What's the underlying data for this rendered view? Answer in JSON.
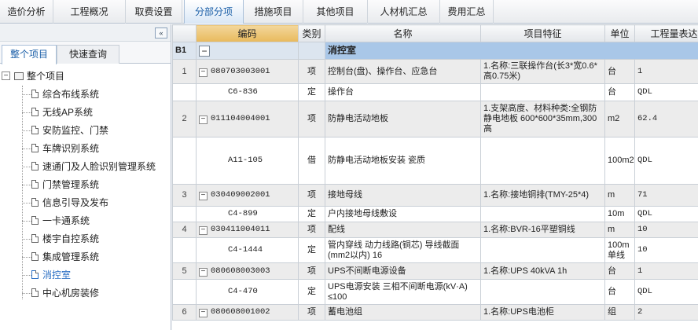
{
  "top_tabs": [
    {
      "label": "造价分析"
    },
    {
      "label": "工程概况"
    },
    {
      "label": "取费设置"
    },
    {
      "label": "分部分项",
      "active": true
    },
    {
      "label": "措施项目"
    },
    {
      "label": "其他项目"
    },
    {
      "label": "人材机汇总"
    },
    {
      "label": "费用汇总"
    }
  ],
  "left": {
    "collapse_glyph": "«",
    "tabs": [
      {
        "label": "整个项目"
      },
      {
        "label": "快速查询"
      }
    ],
    "root": "整个项目",
    "items": [
      "综合布线系统",
      "无线AP系统",
      "安防监控、门禁",
      "车牌识别系统",
      "速通门及人脸识别管理系统",
      "门禁管理系统",
      "信息引导及发布",
      "一卡通系统",
      "楼宇自控系统",
      "集成管理系统",
      "消控室",
      "中心机房装修"
    ],
    "selected": "消控室"
  },
  "grid": {
    "headers": [
      "",
      "编码",
      "类别",
      "名称",
      "项目特征",
      "单位",
      "工程量表达式"
    ],
    "group": {
      "label": "B1",
      "title": "消控室"
    },
    "rows": [
      {
        "type": "item",
        "num": "1",
        "code": "080703003001",
        "kind": "项",
        "name": "控制台(盘)、操作台、应急台",
        "feature": "1.名称:三联操作台(长3*宽0.6*高0.75米)",
        "unit": "台",
        "expr": "1"
      },
      {
        "type": "quota",
        "num": "",
        "code": "C6-836",
        "kind": "定",
        "name": "操作台",
        "feature": "",
        "unit": "台",
        "expr": "QDL"
      },
      {
        "type": "item",
        "num": "2",
        "code": "011104004001",
        "kind": "项",
        "name": "防静电活动地板",
        "feature": "1.支架高度、材料种类:全钢防静电地板 600*600*35mm,300高",
        "unit": "m2",
        "expr": "62.4"
      },
      {
        "type": "quota",
        "num": "",
        "code": "A11-105",
        "kind": "借",
        "name": "防静电活动地板安装 瓷质",
        "feature": "",
        "unit": "100m2",
        "expr": "QDL"
      },
      {
        "type": "item",
        "num": "3",
        "code": "030409002001",
        "kind": "项",
        "name": "接地母线",
        "feature": "1.名称:接地铜排(TMY-25*4)",
        "unit": "m",
        "expr": "71"
      },
      {
        "type": "quota",
        "num": "",
        "code": "C4-899",
        "kind": "定",
        "name": "户内接地母线敷设",
        "feature": "",
        "unit": "10m",
        "expr": "QDL"
      },
      {
        "type": "item",
        "num": "4",
        "code": "030411004011",
        "kind": "项",
        "name": "配线",
        "feature": "1.名称:BVR-16平塑铜线",
        "unit": "m",
        "expr": "10"
      },
      {
        "type": "quota",
        "num": "",
        "code": "C4-1444",
        "kind": "定",
        "name": "管内穿线 动力线路(铜芯) 导线截面(mm2以内) 16",
        "feature": "",
        "unit": "100m单线",
        "expr": "10"
      },
      {
        "type": "item",
        "num": "5",
        "code": "080608003003",
        "kind": "项",
        "name": "UPS不间断电源设备",
        "feature": "1.名称:UPS 40kVA 1h",
        "unit": "台",
        "expr": "1"
      },
      {
        "type": "quota",
        "num": "",
        "code": "C4-470",
        "kind": "定",
        "name": "UPS电源安装 三相不间断电源(kV·A) ≤100",
        "feature": "",
        "unit": "台",
        "expr": "QDL"
      },
      {
        "type": "item",
        "num": "6",
        "code": "080608001002",
        "kind": "项",
        "name": "蓄电池组",
        "feature": "1.名称:UPS电池柜",
        "unit": "组",
        "expr": "2"
      }
    ]
  }
}
